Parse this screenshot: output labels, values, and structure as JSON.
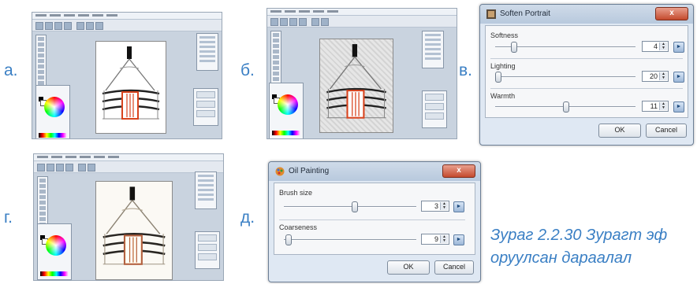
{
  "labels": {
    "a": "а.",
    "b": "б.",
    "v": "в.",
    "g": "г.",
    "d": "д."
  },
  "soften_dialog": {
    "title": "Soften Portrait",
    "close": "x",
    "rows": [
      {
        "label": "Softness",
        "value": "4",
        "level": 0.12
      },
      {
        "label": "Lighting",
        "value": "20",
        "level": 0.0
      },
      {
        "label": "Warmth",
        "value": "11",
        "level": 0.5
      }
    ],
    "ok": "OK",
    "cancel": "Cancel"
  },
  "oil_dialog": {
    "title": "Oil Painting",
    "close": "x",
    "rows": [
      {
        "label": "Brush size",
        "value": "3",
        "level": 0.5
      },
      {
        "label": "Coarseness",
        "value": "9",
        "level": 0.0
      }
    ],
    "ok": "OK",
    "cancel": "Cancel"
  },
  "caption": {
    "line1": "Зураг 2.2.30 Зурагт эф",
    "line2": "оруулсан дараалал"
  },
  "colors": {
    "accent": "#3a7fc4",
    "door": "#d8431d",
    "dialog_bg": "#dfe8f3",
    "close": "#c44a2d"
  },
  "icons": [
    "yurt-drawing",
    "color-wheel-icon",
    "reset-icon",
    "spinner-arrows-icon",
    "close-icon"
  ]
}
